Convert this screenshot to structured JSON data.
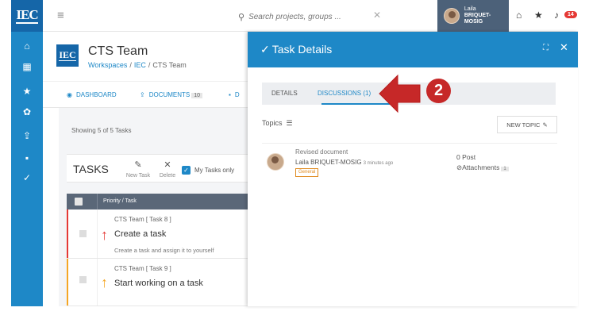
{
  "rail": {
    "logo": "IEC",
    "items": [
      {
        "icon": "home-icon",
        "glyph": "⌂"
      },
      {
        "icon": "workspaces-icon",
        "glyph": "▦"
      },
      {
        "icon": "star-icon",
        "glyph": "★"
      },
      {
        "icon": "settings-icon",
        "glyph": "✿"
      },
      {
        "icon": "upload-icon",
        "glyph": "⇪"
      },
      {
        "icon": "chat-icon",
        "glyph": "■"
      },
      {
        "icon": "check-icon",
        "glyph": "✓"
      }
    ]
  },
  "topbar": {
    "search_placeholder": "Search projects, groups ...",
    "search_clear": "✕",
    "user_first": "Laila",
    "user_last": "BRIQUET-MOSIG",
    "notification_count": "14"
  },
  "workspace": {
    "logo": "IEC",
    "title": "CTS Team",
    "crumb_1": "Workspaces",
    "crumb_2": "IEC",
    "crumb_3": "CTS Team",
    "tab_dashboard": "Dashboard",
    "tab_documents": "Documents",
    "documents_count": "10",
    "tab_cut": "D",
    "showing": "Showing 5 of 5 Tasks",
    "tasks_label": "TASKS",
    "new_task": "New Task",
    "delete": "Delete",
    "my_tasks": "My Tasks only",
    "grid_header": "Priority /  Task",
    "rows": [
      {
        "project": "CTS Team [ Task 8 ]",
        "name": "Create a task",
        "desc": "Create a task and assign it to yourself",
        "color": "#e53935"
      },
      {
        "project": "CTS Team [ Task 9 ]",
        "name": "Start working on a task",
        "desc": "",
        "color": "#f5a623"
      }
    ]
  },
  "panel": {
    "title": "Task Details",
    "tab_details": "Details",
    "tab_discussions": "Discussions (1)",
    "topics_label": "Topics",
    "new_topic": "New Topic",
    "topic": {
      "title": "Revised document",
      "author": "Laila BRIQUET-MOSIG",
      "time": "3 minutes ago",
      "tag": "General",
      "posts": "0 Post",
      "attachments": "Attachments",
      "attachments_count": "1"
    }
  },
  "annotation": {
    "number": "2",
    "color": "#c62828"
  },
  "colors": {
    "primary": "#1e88c7",
    "rail_dark": "#1566a8",
    "user_box": "#4c6179",
    "grid_header": "#5a6778",
    "badge_red": "#e53935"
  }
}
